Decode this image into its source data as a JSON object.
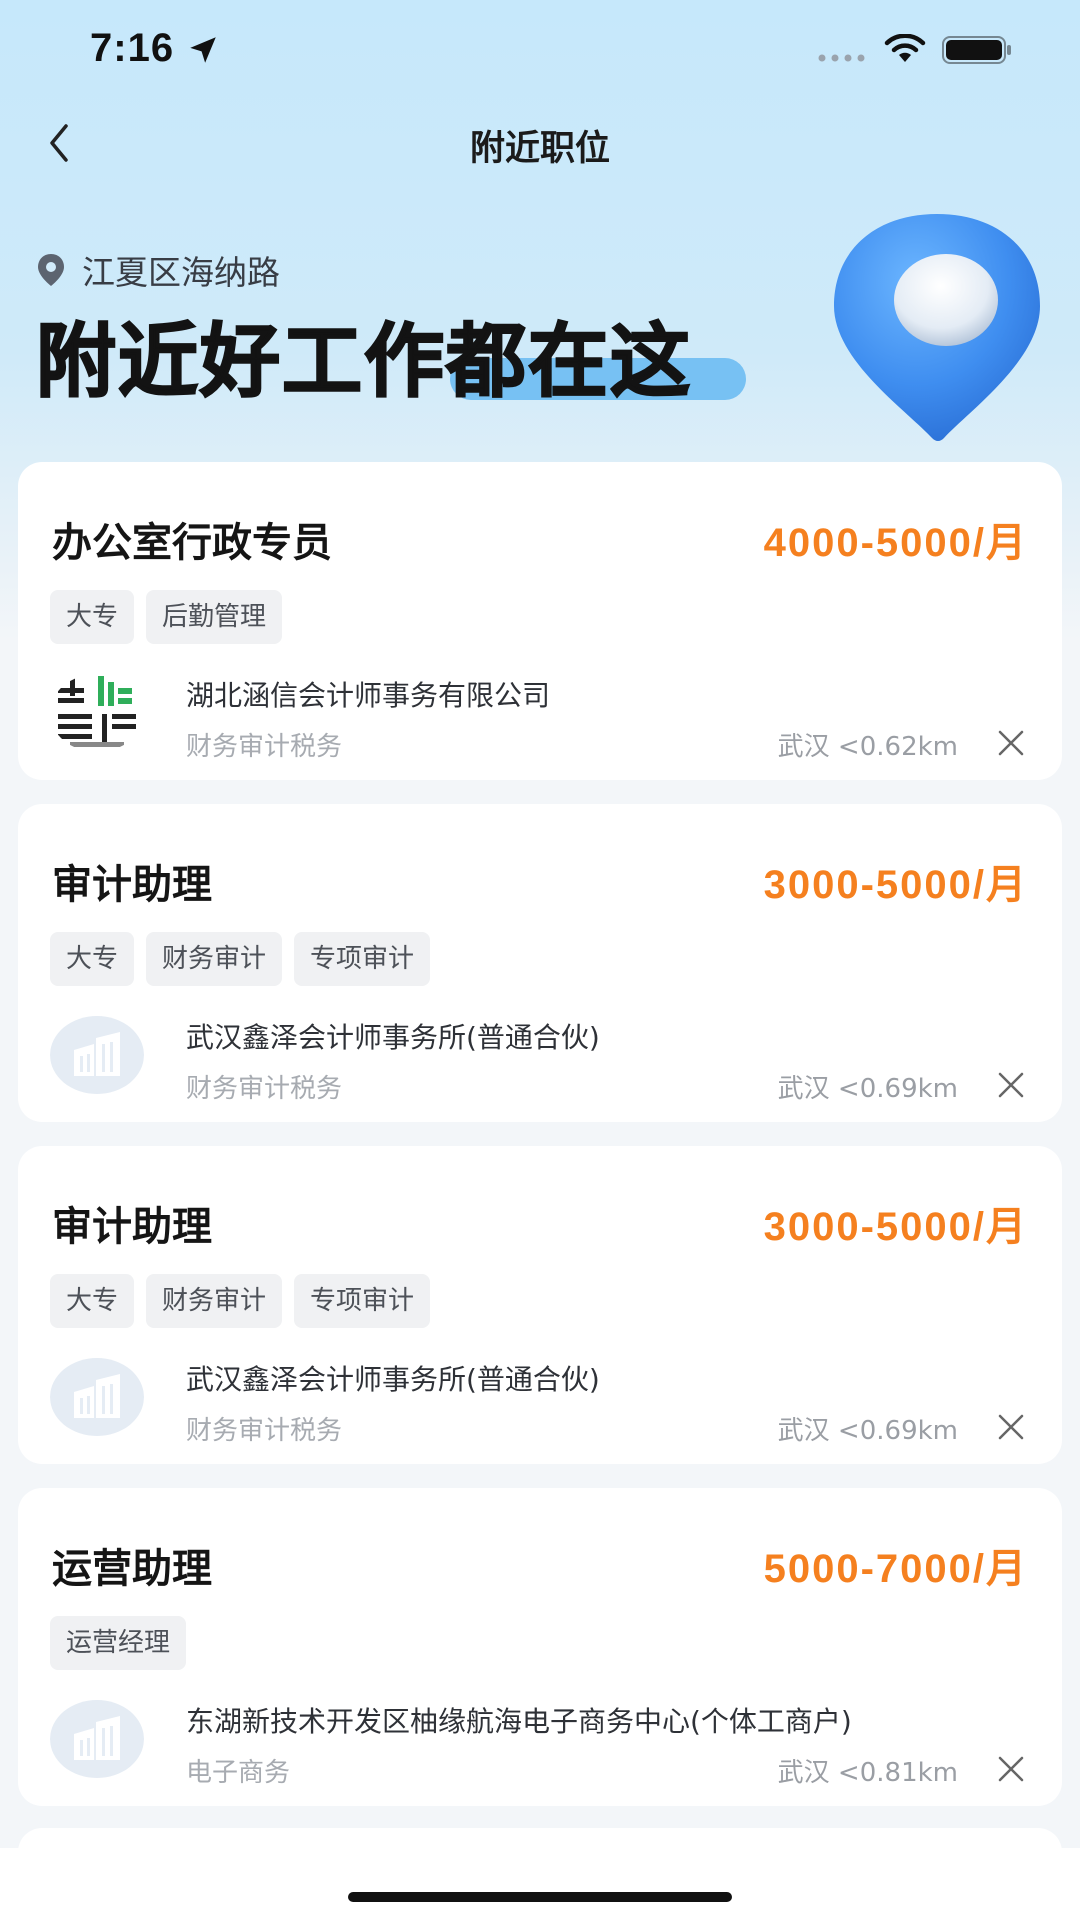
{
  "status_bar": {
    "time": "7:16"
  },
  "nav": {
    "title": "附近职位"
  },
  "hero": {
    "location": "江夏区海纳路",
    "headline": "附近好工作都在这"
  },
  "jobs": [
    {
      "title": "办公室行政专员",
      "salary": "4000-5000/月",
      "tags": [
        "大专",
        "后勤管理"
      ],
      "company": "湖北涵信会计师事务有限公司",
      "industry": "财务审计税务",
      "distance": "武汉 <0.62km",
      "logo": "company-logo-green"
    },
    {
      "title": "审计助理",
      "salary": "3000-5000/月",
      "tags": [
        "大专",
        "财务审计",
        "专项审计"
      ],
      "company": "武汉鑫泽会计师事务所(普通合伙)",
      "industry": "财务审计税务",
      "distance": "武汉 <0.69km",
      "logo": "building-placeholder-icon"
    },
    {
      "title": "审计助理",
      "salary": "3000-5000/月",
      "tags": [
        "大专",
        "财务审计",
        "专项审计"
      ],
      "company": "武汉鑫泽会计师事务所(普通合伙)",
      "industry": "财务审计税务",
      "distance": "武汉 <0.69km",
      "logo": "building-placeholder-icon"
    },
    {
      "title": "运营助理",
      "salary": "5000-7000/月",
      "tags": [
        "运营经理"
      ],
      "company": "东湖新技术开发区柚缘航海电子商务中心(个体工商户)",
      "industry": "电子商务",
      "distance": "武汉 <0.81km",
      "logo": "building-placeholder-icon"
    }
  ],
  "colors": {
    "salary": "#f5801f",
    "header_gradient_top": "#c6e8fb",
    "highlight": "#77c1f3",
    "pin": "#3f8ef0"
  }
}
